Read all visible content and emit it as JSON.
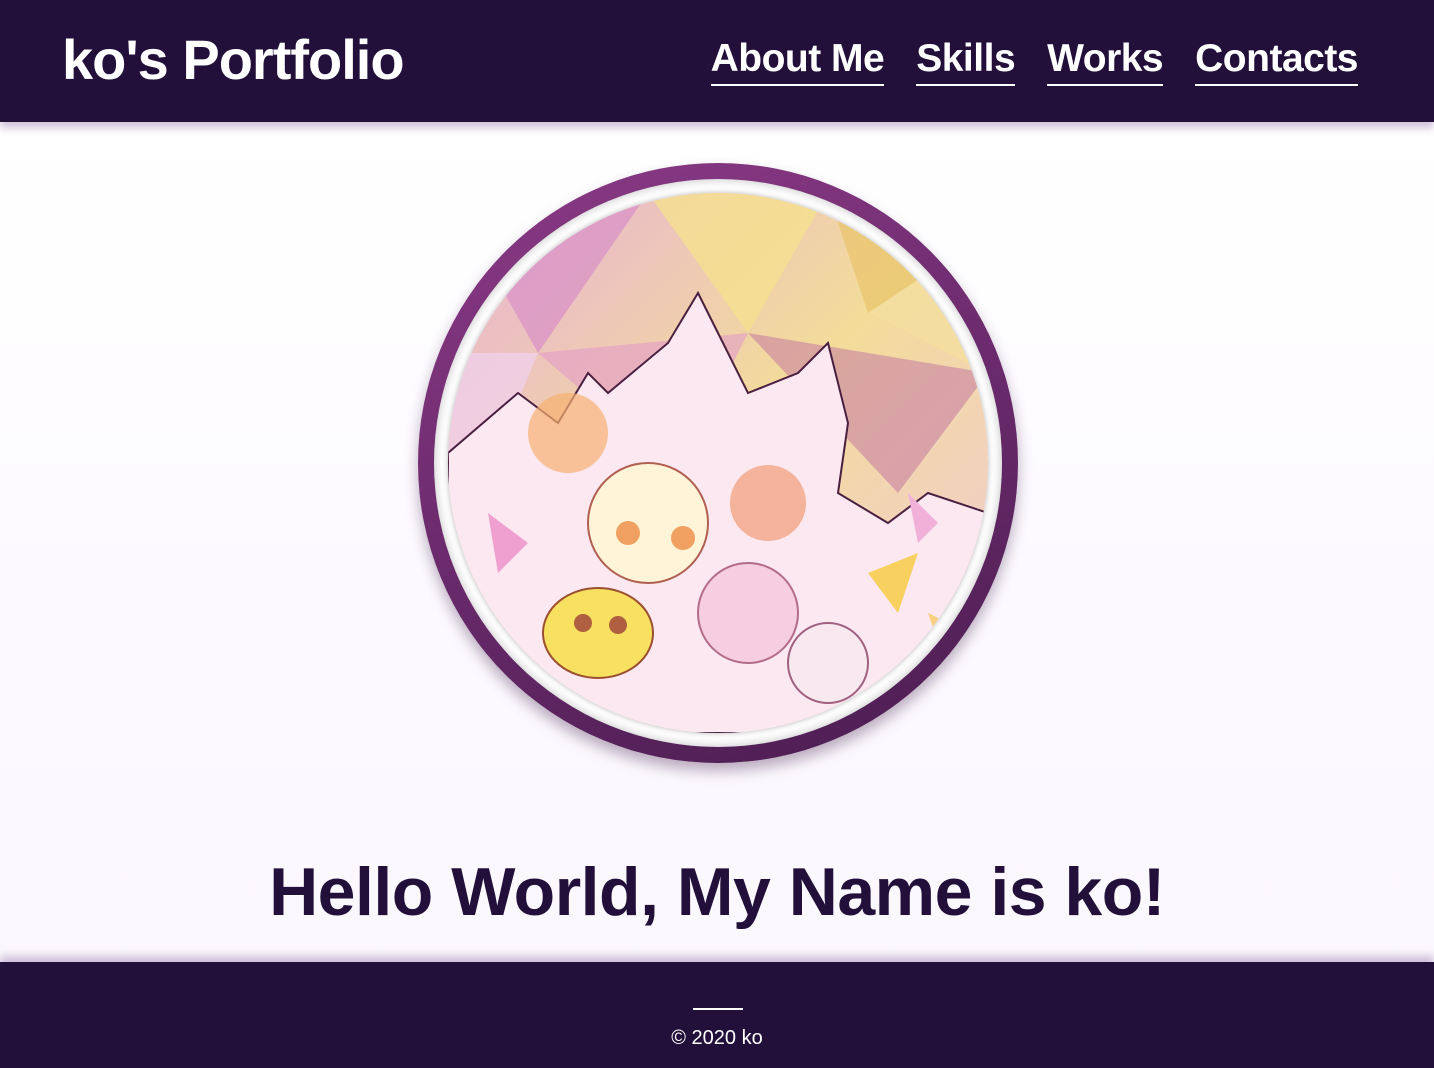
{
  "header": {
    "brand": "ko's Portfolio",
    "nav": [
      {
        "label": "About Me"
      },
      {
        "label": "Skills"
      },
      {
        "label": "Works"
      },
      {
        "label": "Contacts"
      }
    ]
  },
  "hero": {
    "avatar_alt": "profile illustration",
    "greeting": "Hello World, My Name is ko!"
  },
  "footer": {
    "copyright": "© 2020 ko"
  },
  "colors": {
    "primary": "#22103a",
    "ring": "#6a2a6c",
    "background": "#ffffff"
  }
}
